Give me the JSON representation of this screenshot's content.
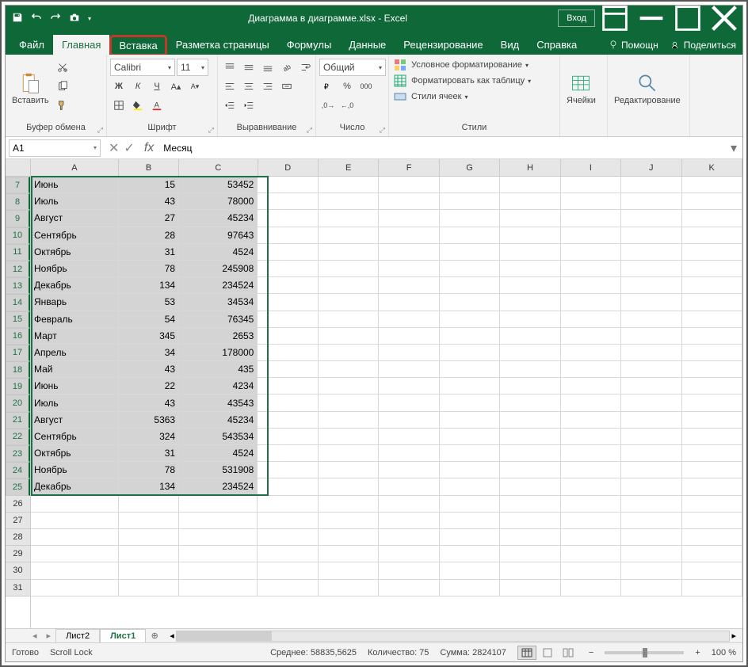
{
  "title": "Диаграмма в диаграмме.xlsx - Excel",
  "login": "Вход",
  "tabs": {
    "file": "Файл",
    "home": "Главная",
    "insert": "Вставка",
    "layout": "Разметка страницы",
    "formulas": "Формулы",
    "data": "Данные",
    "review": "Рецензирование",
    "view": "Вид",
    "help": "Справка",
    "tell": "Помощн",
    "share": "Поделиться"
  },
  "ribbon": {
    "clipboard": {
      "label": "Буфер обмена",
      "paste": "Вставить"
    },
    "font": {
      "label": "Шрифт",
      "name": "Calibri",
      "size": "11"
    },
    "align": {
      "label": "Выравнивание"
    },
    "number": {
      "label": "Число",
      "format": "Общий"
    },
    "styles": {
      "label": "Стили",
      "cond": "Условное форматирование",
      "table": "Форматировать как таблицу",
      "cell": "Стили ячеек"
    },
    "cells": {
      "label": "Ячейки"
    },
    "editing": {
      "label": "Редактирование"
    }
  },
  "namebox": "A1",
  "formula": "Месяц",
  "columns": [
    "A",
    "B",
    "C",
    "D",
    "E",
    "F",
    "G",
    "H",
    "I",
    "J",
    "K"
  ],
  "visible_rows": [
    7,
    8,
    9,
    10,
    11,
    12,
    13,
    14,
    15,
    16,
    17,
    18,
    19,
    20,
    21,
    22,
    23,
    24,
    25,
    26,
    27,
    28,
    29,
    30,
    31
  ],
  "data": {
    "7": [
      "Июнь",
      "15",
      "53452"
    ],
    "8": [
      "Июль",
      "43",
      "78000"
    ],
    "9": [
      "Август",
      "27",
      "45234"
    ],
    "10": [
      "Сентябрь",
      "28",
      "97643"
    ],
    "11": [
      "Октябрь",
      "31",
      "4524"
    ],
    "12": [
      "Ноябрь",
      "78",
      "245908"
    ],
    "13": [
      "Декабрь",
      "134",
      "234524"
    ],
    "14": [
      "Январь",
      "53",
      "34534"
    ],
    "15": [
      "Февраль",
      "54",
      "76345"
    ],
    "16": [
      "Март",
      "345",
      "2653"
    ],
    "17": [
      "Апрель",
      "34",
      "178000"
    ],
    "18": [
      "Май",
      "43",
      "435"
    ],
    "19": [
      "Июнь",
      "22",
      "4234"
    ],
    "20": [
      "Июль",
      "43",
      "43543"
    ],
    "21": [
      "Август",
      "5363",
      "45234"
    ],
    "22": [
      "Сентябрь",
      "324",
      "543534"
    ],
    "23": [
      "Октябрь",
      "31",
      "4524"
    ],
    "24": [
      "Ноябрь",
      "78",
      "531908"
    ],
    "25": [
      "Декабрь",
      "134",
      "234524"
    ]
  },
  "sheets": {
    "s2": "Лист2",
    "s1": "Лист1"
  },
  "status": {
    "ready": "Готово",
    "scroll": "Scroll Lock",
    "avg": "Среднее: 58835,5625",
    "count": "Количество: 75",
    "sum": "Сумма: 2824107",
    "zoom": "100 %"
  }
}
